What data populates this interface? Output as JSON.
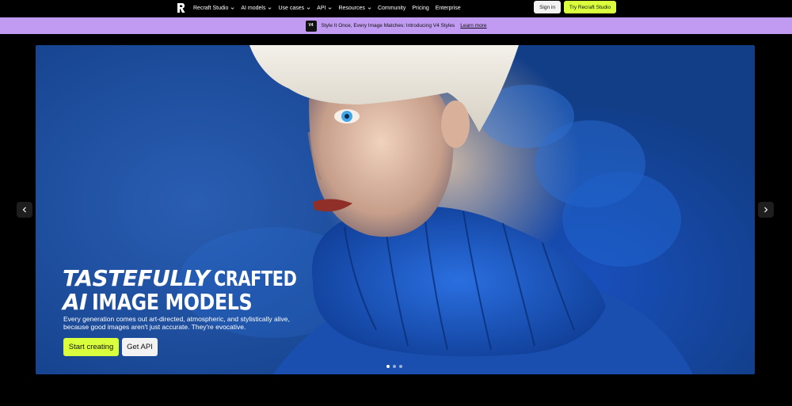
{
  "nav": {
    "items": [
      {
        "label": "Recraft Studio",
        "dropdown": true
      },
      {
        "label": "AI models",
        "dropdown": true
      },
      {
        "label": "Use cases",
        "dropdown": true
      },
      {
        "label": "API",
        "dropdown": true
      },
      {
        "label": "Resources",
        "dropdown": true
      },
      {
        "label": "Community",
        "dropdown": false
      },
      {
        "label": "Pricing",
        "dropdown": false
      },
      {
        "label": "Enterprise",
        "dropdown": false
      }
    ],
    "sign_in": "Sign in",
    "try_studio": "Try Recraft Studio"
  },
  "banner": {
    "badge": "V4",
    "text": "Style It Once, Every Image Matches: Introducing V4 Styles",
    "link": "Learn more"
  },
  "hero": {
    "title_italic_1": "TASTEFULLY",
    "title_cond_1": "CRAFTED",
    "title_italic_2": "AI",
    "title_cond_2": "IMAGE MODELS",
    "subtitle": "Every generation comes out art-directed, atmospheric, and stylistically alive, because good images aren't just accurate. They're evocative.",
    "cta_primary": "Start creating",
    "cta_secondary": "Get API",
    "slides": 3,
    "active_slide": 0
  },
  "colors": {
    "accent_lime": "#d9ff3d",
    "banner_lilac": "#c19bf2",
    "hero_blue": "#1c4fa3"
  },
  "icons": {
    "logo": "recraft-logo",
    "prev": "chevron-left-icon",
    "next": "chevron-right-icon",
    "dropdown": "chevron-down-icon"
  }
}
